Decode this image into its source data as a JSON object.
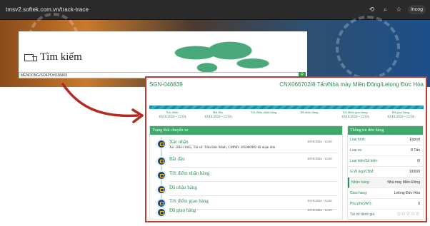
{
  "browser": {
    "url": "tmsv2.softek.com.vn/track-trace",
    "icons": [
      "translate-icon",
      "zoom-icon",
      "star-icon"
    ],
    "profile_label": "Incog"
  },
  "search": {
    "title": "Tìm kiếm",
    "value": "MENDONG/SO4PO#O38465",
    "button_icon": "search-icon"
  },
  "shipment": {
    "code": "SGN-046839",
    "route": "CNX066702/8 Tấn/Nhà máy Miền Đông/Lelong Đức Hòa"
  },
  "progress_steps": [
    {
      "label": "Xác nhận",
      "date": "10/10/2024 - 12:04"
    },
    {
      "label": "Bắt đầu",
      "date": "10/10/2024 - 12:04"
    },
    {
      "label": "Tới điểm nhận hàng",
      "date": ""
    },
    {
      "label": "Đã nhận hàng",
      "date": ""
    },
    {
      "label": "Tới điểm giao hàng",
      "date": "10/10/2024 - 12:04"
    },
    {
      "label": "Đã giao hàng",
      "date": "10/10/2024 - 12:04"
    }
  ],
  "status_section": {
    "title": "Trạng thái chuyến xe",
    "events": [
      {
        "title": "Xác nhận",
        "date": "10/10/2024 - 12:04",
        "detail": "Xe: 50H-11665, Tài xế: Trần Đức Minh, CMND: 285086982 đã nhận đơn"
      },
      {
        "title": "Bắt đầu",
        "date": "10/10/2024 - 12:04",
        "detail": ""
      },
      {
        "title": "Tới điểm nhận hàng",
        "date": "",
        "detail": ""
      },
      {
        "title": "Đã nhận hàng",
        "date": "",
        "detail": ""
      },
      {
        "title": "Tới điểm giao hàng",
        "date": "10/10/2024 - 12:04",
        "detail": ""
      },
      {
        "title": "Đã giao hàng",
        "date": "10/10/2024 - 12:04",
        "detail": ""
      }
    ]
  },
  "order_info": {
    "title": "Thông tin đơn hàng",
    "rows": [
      {
        "key": "Loại hình:",
        "value": "Export"
      },
      {
        "key": "Loại xe:",
        "value": "8 Tấn"
      },
      {
        "key": "Loại kiện/Số kiện:",
        "value": "/0"
      },
      {
        "key": "G.W (kg)/CBM:",
        "value": "1000/0"
      },
      {
        "key": "Nhận hàng:",
        "value": "Nhà máy Miền Đông"
      },
      {
        "key": "Giao hàng:",
        "value": "Lelong Đức Hòa"
      },
      {
        "key": "Phụ phí(VAT):",
        "value": "0"
      },
      {
        "key": "Tài xế đánh giá",
        "value": "☆☆☆☆☆"
      }
    ]
  },
  "colors": {
    "accent_green": "#3fa86a",
    "highlight_red": "#c0392b",
    "stripe_teal": "#1a8ca8",
    "timeline_dot": "#1f4b7a"
  }
}
